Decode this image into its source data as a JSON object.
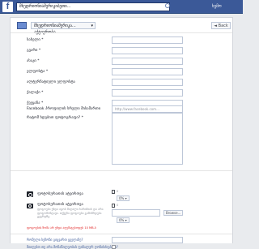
{
  "topbar": {
    "search_value": "მხედრიონიამერიკიბეთი...",
    "user_link": "ხემო"
  },
  "toolbar": {
    "page_select_label": "მხედრიონიამერიკა...  აქტიურობა...",
    "back_label": "◄ Back"
  },
  "form": {
    "fields": [
      {
        "label": "სახელი *",
        "value": ""
      },
      {
        "label": "გვარი *",
        "value": ""
      },
      {
        "label": "ასაკი *",
        "value": ""
      },
      {
        "label": "ელფოსტა *",
        "value": ""
      },
      {
        "label": "ალტერნატიული ელფოსტა",
        "value": ""
      },
      {
        "label": "ქალაქი *",
        "value": ""
      },
      {
        "label": "ქვეყანა *",
        "value": ""
      },
      {
        "label": "Facebook პროფილის სრული მისამართი",
        "value": "",
        "placeholder": "http://www.facebook.com..."
      }
    ],
    "textarea_label": "რატომ ხდებით ფოტოგრაფი? *",
    "photo1": {
      "label": "ფოტოსურათის ატვირთვა",
      "percent": "0%",
      "num_marker": "0"
    },
    "photo2": {
      "label": "ფოტოსურათის ატვირთვა",
      "desc": "ფოტოები უნდა იყოს მაღალი ხარისხის და არა ფოტომონტაჟი. თქვენი ფოტოები გამოჩნდება გვერდზე.",
      "browse_label": "Browse...",
      "percent": "0%",
      "num_marker": "0"
    },
    "warning": "ფოტოების ზომა არ უნდა აღემატებოდეს 10 MB-ს",
    "question1": "რომელი სეზონი გიყვართ ყველაზე?",
    "question2": "მიიღებთ თუ არა მონაწილეობას ფინალურ ღონისძიებაში?"
  }
}
